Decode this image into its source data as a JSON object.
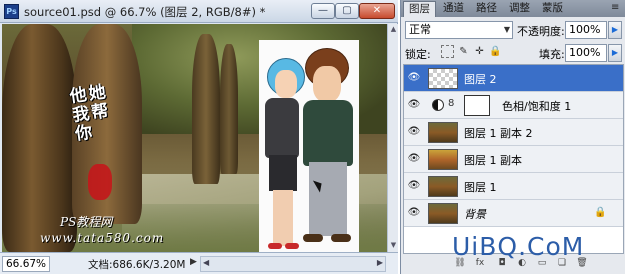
{
  "document": {
    "app_icon": "Ps",
    "title": "source01.psd @ 66.7% (图层 2, RGB/8#) *",
    "controls": {
      "minimize": "—",
      "maximize": "▢",
      "close": "✕"
    },
    "canvas": {
      "calligraphy": [
        "他",
        "她",
        "我",
        "帮",
        "你"
      ],
      "watermark_line1": "PS教程网",
      "watermark_line2": "www.tata580.com"
    },
    "status": {
      "zoom": "66.67%",
      "doc_info": "文档:686.6K/3.20M",
      "menu_arrow": "▶"
    },
    "scroll_icons": {
      "up": "▲",
      "down": "▼",
      "left": "◀",
      "right": "▶"
    }
  },
  "layers_panel": {
    "tabs": [
      "图层",
      "通道",
      "路径",
      "调整",
      "蒙版"
    ],
    "active_tab": 0,
    "menu_icon": "≡",
    "blend_mode": "正常",
    "dropdown_arrow": "▼",
    "opacity_label": "不透明度:",
    "opacity_value": "100%",
    "lock_label": "锁定:",
    "fill_label": "填充:",
    "fill_value": "100%",
    "flyout_arrow": "▶",
    "icons": {
      "eye": "👁",
      "lock_paint": "✎",
      "lock_move": "✛",
      "lock_all": "🔒",
      "chain": "8",
      "bg_lock": "🔒"
    },
    "layers": [
      {
        "name": "图层 2",
        "selected": true
      },
      {
        "name": "色相/饱和度 1",
        "selected": false
      },
      {
        "name": "图层 1 副本 2",
        "selected": false
      },
      {
        "name": "图层 1 副本",
        "selected": false
      },
      {
        "name": "图层 1",
        "selected": false
      },
      {
        "name": "背景",
        "selected": false
      }
    ],
    "bottom_icons": [
      "⛓",
      "fx",
      "◘",
      "◐",
      "▭",
      "❏",
      "🗑"
    ]
  },
  "brand": "UiBQ.CoM",
  "colors": {
    "selection": "#3a6fc8",
    "brand": "#2c5da8",
    "flyout_arrow": "#1b6bd6"
  }
}
